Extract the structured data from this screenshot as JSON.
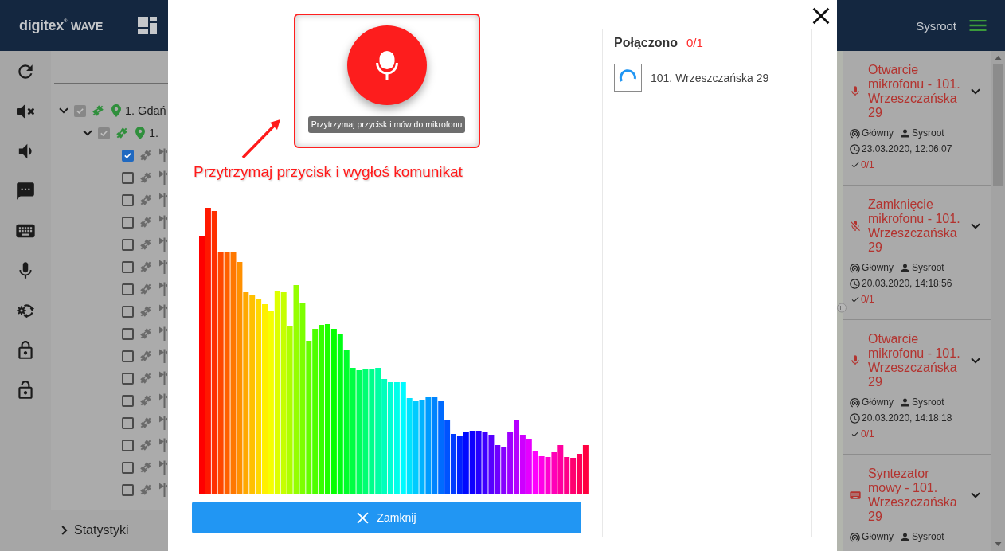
{
  "header": {
    "logo": {
      "brand": "digitex$^{®}$",
      "product": "WAVE"
    },
    "user": "Sysroot"
  },
  "tree": {
    "items": [
      {
        "label": "1. Gdań",
        "kind": "location",
        "expanded": true,
        "checked": true,
        "disabled": true,
        "connected": true,
        "children": [
          {
            "label": "1.",
            "kind": "location",
            "expanded": true,
            "checked": true,
            "disabled": true,
            "connected": true,
            "children": [
              {
                "kind": "device",
                "checked": true,
                "disabled": false,
                "connected": false
              },
              {
                "kind": "device",
                "checked": false,
                "disabled": false,
                "connected": false
              },
              {
                "kind": "device",
                "checked": false,
                "disabled": false,
                "connected": false
              },
              {
                "kind": "device",
                "checked": false,
                "disabled": false,
                "connected": false
              },
              {
                "kind": "device",
                "checked": false,
                "disabled": false,
                "connected": false
              },
              {
                "kind": "device",
                "checked": false,
                "disabled": false,
                "connected": false
              },
              {
                "kind": "device",
                "checked": false,
                "disabled": false,
                "connected": false
              },
              {
                "kind": "device",
                "checked": false,
                "disabled": false,
                "connected": false
              },
              {
                "kind": "device",
                "checked": false,
                "disabled": false,
                "connected": false
              },
              {
                "kind": "device",
                "checked": false,
                "disabled": false,
                "connected": false
              },
              {
                "kind": "device",
                "checked": false,
                "disabled": false,
                "connected": false
              },
              {
                "kind": "device",
                "checked": false,
                "disabled": false,
                "connected": false
              },
              {
                "kind": "device",
                "checked": false,
                "disabled": false,
                "connected": false
              },
              {
                "kind": "device",
                "checked": false,
                "disabled": false,
                "connected": false
              },
              {
                "kind": "device",
                "checked": false,
                "disabled": false,
                "connected": false
              },
              {
                "kind": "device",
                "checked": false,
                "disabled": false,
                "connected": false
              }
            ]
          }
        ]
      }
    ]
  },
  "statistics": {
    "label": "Statystyki",
    "expanded": false
  },
  "dialog": {
    "mic_button": {
      "tooltip": "Przytrzymaj przycisk i mów do mikrofonu"
    },
    "annotation": "Przytrzymaj przycisk i wygłoś komunikat",
    "close_button": {
      "label": "Zamknij"
    },
    "connections": {
      "title": "Połączono",
      "count": "0/1",
      "items": [
        {
          "label": "101. Wrzeszczańska 29",
          "connecting": true
        }
      ]
    }
  },
  "events": [
    {
      "kind": "mic_open",
      "title": "Otwarcie mikrofonu - 101. Wrzeszczańska 29",
      "channel": "Główny",
      "user": "Sysroot",
      "time": "23.03.2020, 12:06:07",
      "confirmations": "0/1"
    },
    {
      "kind": "mic_close",
      "title": "Zamknięcie mikrofonu - 101. Wrzeszczańska 29",
      "channel": "Główny",
      "user": "Sysroot",
      "time": "20.03.2020, 14:18:56",
      "confirmations": "0/1"
    },
    {
      "kind": "mic_open",
      "title": "Otwarcie mikrofonu - 101. Wrzeszczańska 29",
      "channel": "Główny",
      "user": "Sysroot",
      "time": "20.03.2020, 14:18:18",
      "confirmations": "0/1"
    },
    {
      "kind": "tts",
      "title": "Syntezator mowy - 101. Wrzeszczańska 29",
      "channel": "Główny",
      "user": "Sysroot"
    }
  ]
}
